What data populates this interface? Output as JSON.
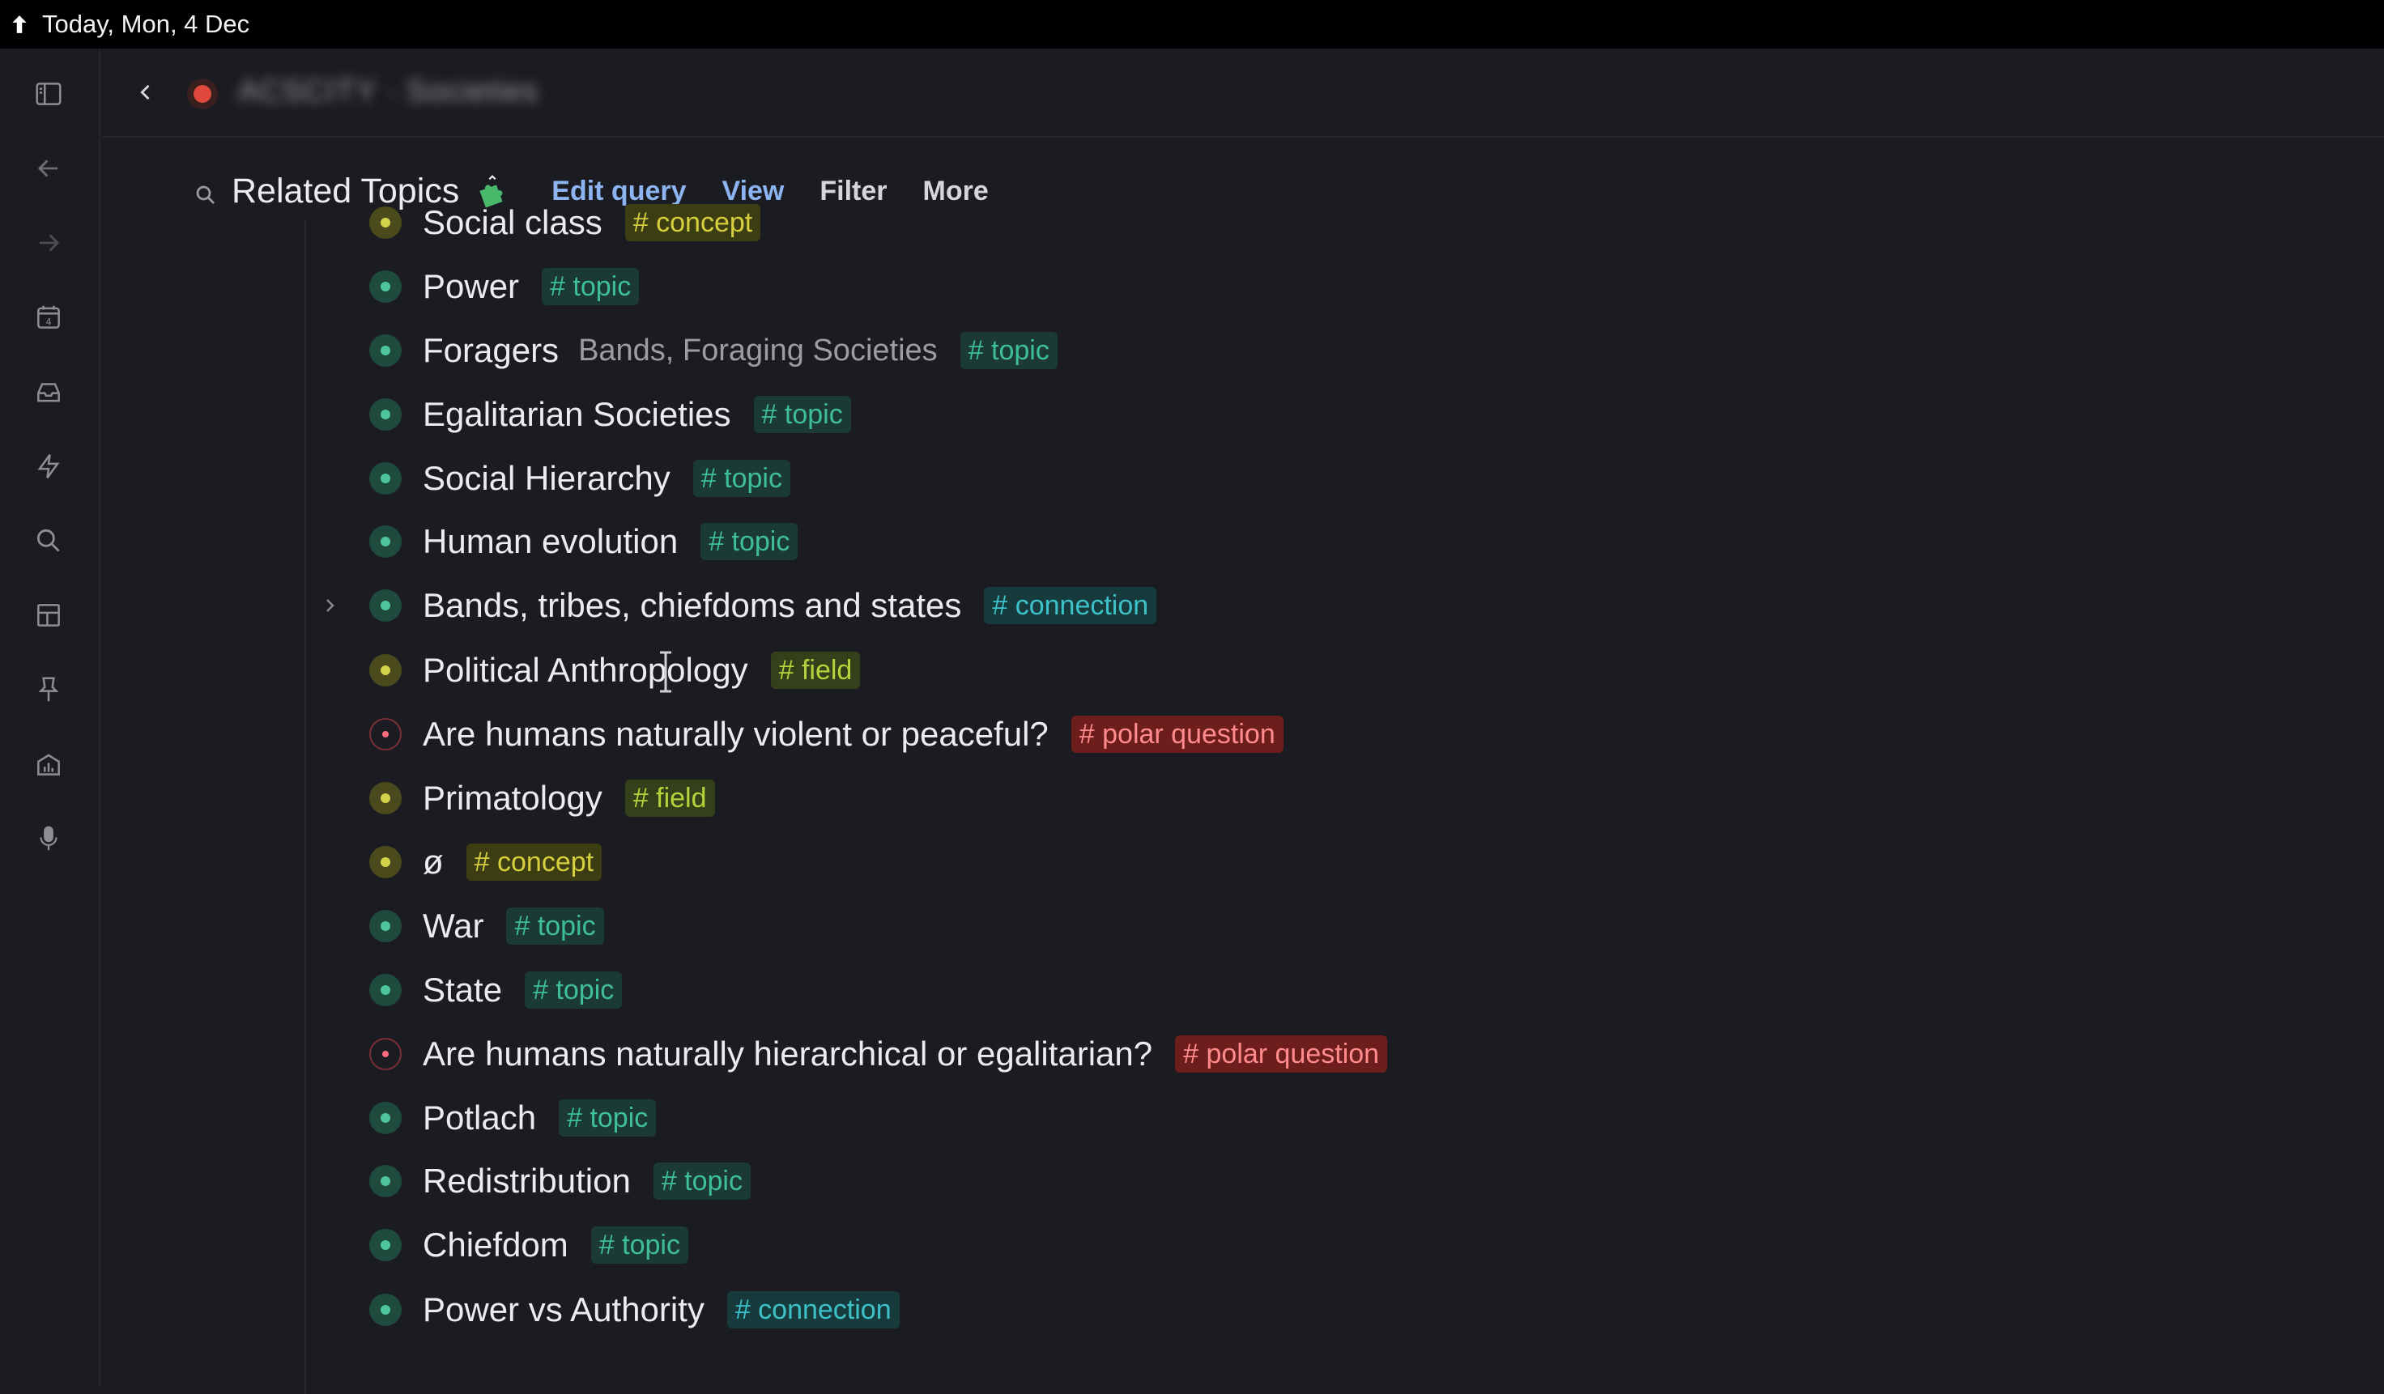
{
  "titlebar": {
    "title": "Today, Mon, 4 Dec"
  },
  "topbar": {
    "page_crumb": "ACSCITY · Societies"
  },
  "query": {
    "title": "Related Topics",
    "edit_label": "Edit query",
    "view_label": "View",
    "filter_label": "Filter",
    "more_label": "More"
  },
  "colors": {
    "topic": "#3fbf95",
    "connection": "#3cc2c8",
    "concept": "#d6cf3e",
    "field": "#b7d23a",
    "polar_question": "#ff8b8b"
  },
  "rows": [
    {
      "title": "Social class",
      "alias": "",
      "tag": "# concept",
      "bullet": "yellow"
    },
    {
      "title": "Power",
      "alias": "",
      "tag": "# topic",
      "bullet": "green"
    },
    {
      "title": "Foragers",
      "alias": "Bands, Foraging Societies",
      "tag": "# topic",
      "bullet": "green"
    },
    {
      "title": "Egalitarian Societies",
      "alias": "",
      "tag": "# topic",
      "bullet": "green"
    },
    {
      "title": "Social Hierarchy",
      "alias": "",
      "tag": "# topic",
      "bullet": "green"
    },
    {
      "title": "Human evolution",
      "alias": "",
      "tag": "# topic",
      "bullet": "green"
    },
    {
      "title": "Bands, tribes, chiefdoms and states",
      "alias": "",
      "tag": "# connection",
      "bullet": "green"
    },
    {
      "title": "Political Anthropology",
      "alias": "",
      "tag": "# field",
      "bullet": "yellow"
    },
    {
      "title": "Are humans naturally violent or peaceful?",
      "alias": "",
      "tag": "# polar question",
      "bullet": "red"
    },
    {
      "title": "Primatology",
      "alias": "",
      "tag": "# field",
      "bullet": "yellow"
    },
    {
      "title": "ø",
      "alias": "",
      "tag": "# concept",
      "bullet": "yellow"
    },
    {
      "title": "War",
      "alias": "",
      "tag": "# topic",
      "bullet": "green"
    },
    {
      "title": "State",
      "alias": "",
      "tag": "# topic",
      "bullet": "green"
    },
    {
      "title": "Are humans naturally hierarchical or egalitarian?",
      "alias": "",
      "tag": "# polar question",
      "bullet": "red"
    },
    {
      "title": "Potlach",
      "alias": "",
      "tag": "# topic",
      "bullet": "green"
    },
    {
      "title": "Redistribution",
      "alias": "",
      "tag": "# topic",
      "bullet": "green"
    },
    {
      "title": "Chiefdom",
      "alias": "",
      "tag": "# topic",
      "bullet": "green"
    },
    {
      "title": "Power vs Authority",
      "alias": "",
      "tag": "# connection",
      "bullet": "green"
    }
  ],
  "sidebar": {
    "icons": [
      "sidebar-toggle-icon",
      "back-arrow-icon",
      "forward-arrow-icon",
      "calendar-icon",
      "inbox-icon",
      "lightning-icon",
      "search-icon",
      "layout-icon",
      "pin-icon",
      "analytics-icon",
      "microphone-icon"
    ]
  }
}
